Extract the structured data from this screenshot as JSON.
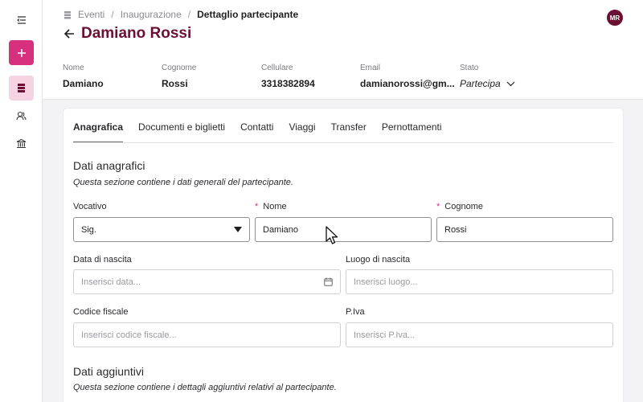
{
  "sidebar": {
    "items": [
      {
        "name": "menu-icon"
      },
      {
        "name": "add-button"
      },
      {
        "name": "list-icon"
      },
      {
        "name": "users-icon"
      },
      {
        "name": "building-icon"
      }
    ]
  },
  "breadcrumb": {
    "items": [
      "Eventi",
      "Inaugurazione"
    ],
    "current": "Dettaglio partecipante"
  },
  "header": {
    "title": "Damiano Rossi",
    "avatar_initials": "MR",
    "info": [
      {
        "label": "Nome",
        "value": "Damiano"
      },
      {
        "label": "Cognome",
        "value": "Rossi"
      },
      {
        "label": "Cellulare",
        "value": "3318382894"
      },
      {
        "label": "Email",
        "value": "damianorossi@gm..."
      },
      {
        "label": "Stato",
        "value": "Partecipa"
      }
    ]
  },
  "tabs": [
    "Anagrafica",
    "Documenti e biglietti",
    "Contatti",
    "Viaggi",
    "Transfer",
    "Pernottamenti"
  ],
  "active_tab": "Anagrafica",
  "sections": {
    "anagrafici": {
      "title": "Dati anagrafici",
      "description": "Questa sezione contiene i dati generali del partecipante."
    },
    "aggiuntivi": {
      "title": "Dati aggiuntivi",
      "description": "Questa sezione contiene i dettagli aggiuntivi relativi al partecipante."
    }
  },
  "form": {
    "vocativo": {
      "label": "Vocativo",
      "value": "Sig."
    },
    "nome": {
      "label": "Nome",
      "required": "*",
      "value": "Damiano"
    },
    "cognome": {
      "label": "Cognome",
      "required": "*",
      "value": "Rossi"
    },
    "data_nascita": {
      "label": "Data di nascita",
      "placeholder": "Inserisci data..."
    },
    "luogo_nascita": {
      "label": "Luogo di nascita",
      "placeholder": "Inserisci luogo..."
    },
    "codice_fiscale": {
      "label": "Codice fiscale",
      "placeholder": "Inserisci codice fiscale..."
    },
    "piva": {
      "label": "P.Iva",
      "placeholder": "Inserisci P.Iva..."
    }
  },
  "colors": {
    "accent": "#d6307f",
    "brand": "#6b1035",
    "active_bg": "#f6d3e3"
  }
}
